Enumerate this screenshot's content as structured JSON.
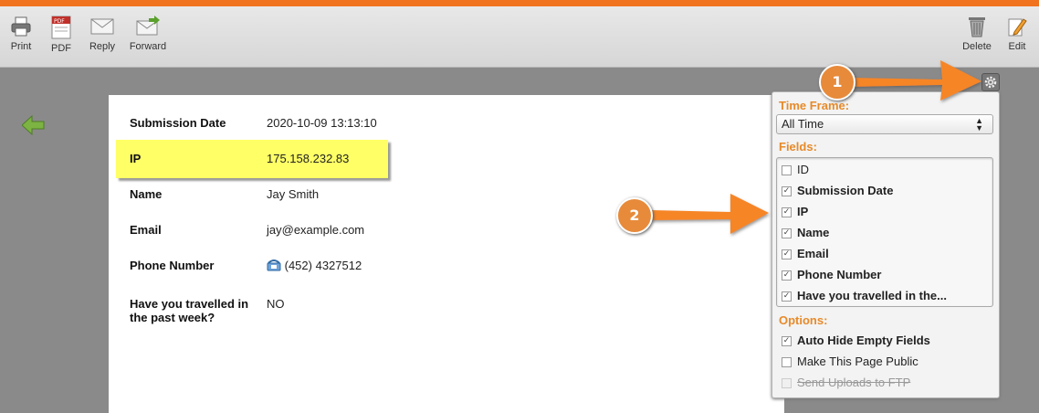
{
  "toolbar": {
    "print": "Print",
    "pdf": "PDF",
    "reply": "Reply",
    "forward": "Forward",
    "delete": "Delete",
    "edit": "Edit"
  },
  "submission": {
    "date_label": "Submission Date",
    "date_value": "2020-10-09 13:13:10",
    "ip_label": "IP",
    "ip_value": "175.158.232.83",
    "name_label": "Name",
    "name_value": "Jay Smith",
    "email_label": "Email",
    "email_value": "jay@example.com",
    "phone_label": "Phone Number",
    "phone_value": "(452) 4327512",
    "travel_label_line1": "Have you travelled in",
    "travel_label_line2": "the past week?",
    "travel_value": "NO"
  },
  "panel": {
    "time_frame_title": "Time Frame:",
    "time_frame_value": "All Time",
    "fields_title": "Fields:",
    "fields": [
      {
        "label": "ID",
        "checked": false
      },
      {
        "label": "Submission Date",
        "checked": true
      },
      {
        "label": "IP",
        "checked": true
      },
      {
        "label": "Name",
        "checked": true
      },
      {
        "label": "Email",
        "checked": true
      },
      {
        "label": "Phone Number",
        "checked": true
      },
      {
        "label": "Have you travelled in the...",
        "checked": true
      }
    ],
    "options_title": "Options:",
    "options": [
      {
        "label": "Auto Hide Empty Fields",
        "checked": true
      },
      {
        "label": "Make This Page Public",
        "checked": false
      },
      {
        "label": "Send Uploads to FTP",
        "checked": false,
        "disabled": true
      }
    ]
  },
  "annotations": {
    "badge1": "1",
    "badge2": "2"
  },
  "colors": {
    "accent_orange": "#f2731f",
    "section_title": "#e78a2a",
    "highlight": "#ffff66"
  }
}
